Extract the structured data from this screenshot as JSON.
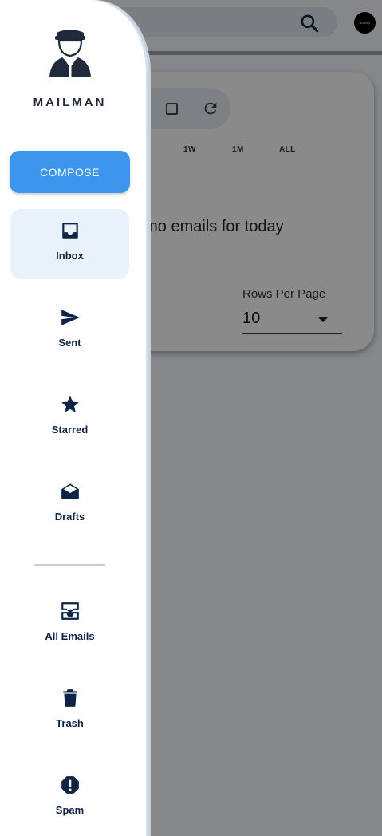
{
  "app": {
    "avatar_text": "ADMIN",
    "search_icon": "search-icon",
    "time_ranges": [
      "1W",
      "1M",
      "ALL"
    ],
    "empty_message": "e no emails for today",
    "rows_per_page_label": "Rows Per Page",
    "rows_per_page_value": "10"
  },
  "drawer": {
    "brand": "MAILMAN",
    "logo_icon": "mailman-logo-icon",
    "compose_label": "COMPOSE",
    "accent_color": "#3d95ee",
    "items": [
      {
        "label": "Inbox",
        "icon": "inbox-icon",
        "active": true
      },
      {
        "label": "Sent",
        "icon": "send-icon",
        "active": false
      },
      {
        "label": "Starred",
        "icon": "star-icon",
        "active": false
      },
      {
        "label": "Drafts",
        "icon": "drafts-icon",
        "active": false
      },
      {
        "label": "All Emails",
        "icon": "all-mail-icon",
        "active": false
      },
      {
        "label": "Trash",
        "icon": "trash-icon",
        "active": false
      },
      {
        "label": "Spam",
        "icon": "spam-icon",
        "active": false
      }
    ]
  }
}
